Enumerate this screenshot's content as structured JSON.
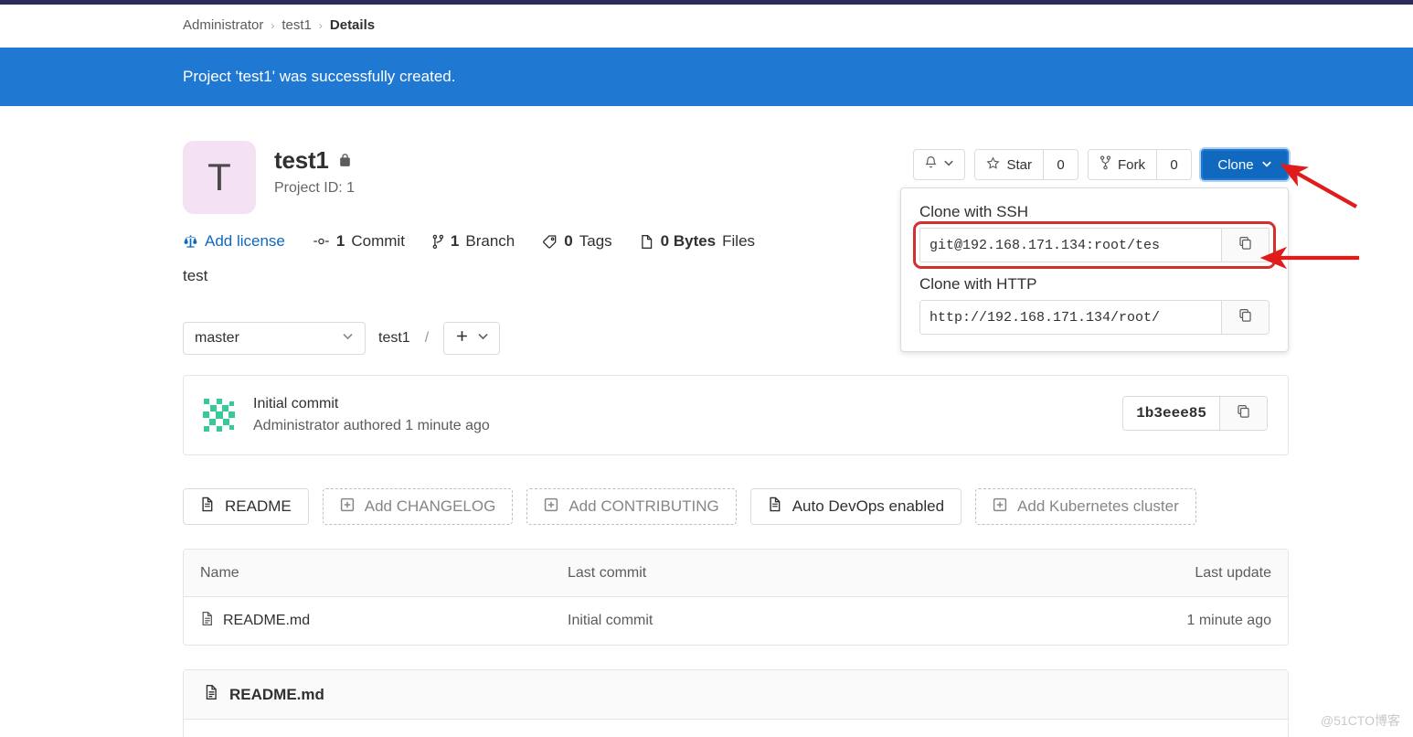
{
  "breadcrumb": {
    "items": [
      {
        "label": "Administrator",
        "current": false
      },
      {
        "label": "test1",
        "current": false
      },
      {
        "label": "Details",
        "current": true
      }
    ],
    "separator": "›"
  },
  "alert": {
    "message": "Project 'test1' was successfully created.",
    "background": "#1f78d1"
  },
  "project": {
    "avatar_letter": "T",
    "name": "test1",
    "visibility_icon": "lock-icon",
    "project_id_label": "Project ID: 1",
    "description": "test",
    "stats": [
      {
        "icon": "scales-icon",
        "label": "Add license",
        "value": "",
        "link": true
      },
      {
        "icon": "commit-icon",
        "label": "Commit",
        "value": "1",
        "link": false
      },
      {
        "icon": "branch-icon",
        "label": "Branch",
        "value": "1",
        "link": false
      },
      {
        "icon": "tag-icon",
        "label": "Tags",
        "value": "0",
        "link": false
      },
      {
        "icon": "file-icon",
        "label": "Files",
        "value": "0 Bytes",
        "link": false
      }
    ]
  },
  "actions": {
    "notify_icon": "bell-icon",
    "notify_caret_icon": "chevron-down-icon",
    "star_icon": "star-icon",
    "star_label": "Star",
    "star_count": "0",
    "fork_icon": "fork-icon",
    "fork_label": "Fork",
    "fork_count": "0",
    "clone_label": "Clone",
    "clone_caret_icon": "chevron-down-icon",
    "clone_button_color": "#1068bf"
  },
  "clone_dropdown": {
    "ssh_label": "Clone with SSH",
    "ssh_url": "git@192.168.171.134:root/tes",
    "ssh_copy_icon": "copy-icon",
    "http_label": "Clone with HTTP",
    "http_url": "http://192.168.171.134/root/",
    "http_copy_icon": "copy-icon",
    "highlight_color": "#d32f2f"
  },
  "branch_row": {
    "branch_name": "master",
    "branch_caret_icon": "chevron-down-icon",
    "path_root": "test1",
    "path_separator": "/",
    "add_icon": "plus-icon",
    "add_caret_icon": "chevron-down-icon"
  },
  "commit": {
    "avatar": "identicon-avatar",
    "title": "Initial commit",
    "subtitle": "Administrator authored 1 minute ago",
    "sha": "1b3eee85",
    "copy_icon": "copy-icon"
  },
  "quick_actions": [
    {
      "icon": "file-icon",
      "label": "README",
      "dashed": false
    },
    {
      "icon": "plus-box-icon",
      "label": "Add CHANGELOG",
      "dashed": true
    },
    {
      "icon": "plus-box-icon",
      "label": "Add CONTRIBUTING",
      "dashed": true
    },
    {
      "icon": "file-icon",
      "label": "Auto DevOps enabled",
      "dashed": false
    },
    {
      "icon": "plus-box-icon",
      "label": "Add Kubernetes cluster",
      "dashed": true
    }
  ],
  "file_table": {
    "columns": [
      "Name",
      "Last commit",
      "Last update"
    ],
    "rows": [
      {
        "icon": "file-doc-icon",
        "name": "README.md",
        "last_commit": "Initial commit",
        "last_update": "1 minute ago"
      }
    ]
  },
  "readme": {
    "icon": "file-doc-icon",
    "title": "README.md"
  },
  "watermark": {
    "text": "@51CTO博客"
  }
}
